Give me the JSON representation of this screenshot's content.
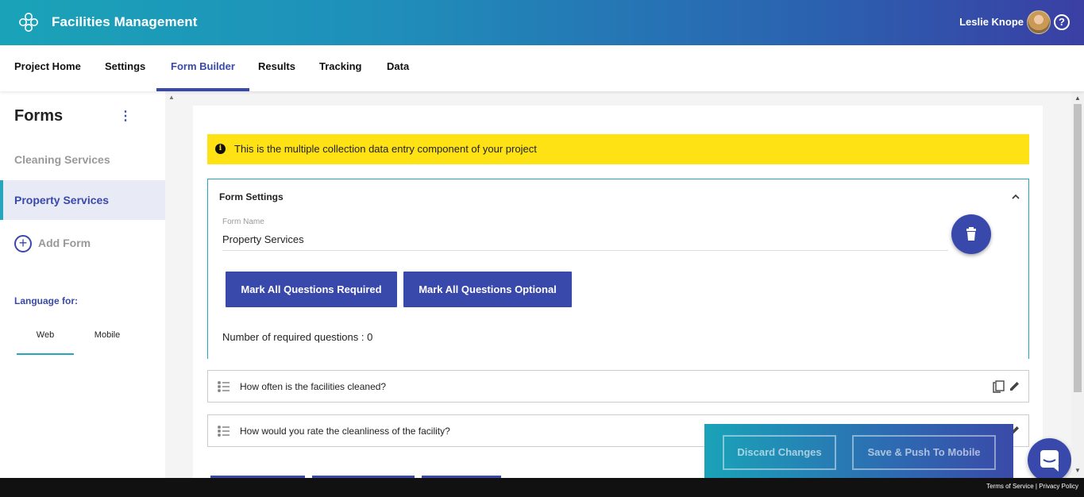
{
  "header": {
    "app_title": "Facilities Management",
    "user_name": "Leslie Knope",
    "logo_icon": "flower-logo-icon",
    "help_icon": "question-circle-icon",
    "help_glyph": "?"
  },
  "nav": {
    "tabs": [
      {
        "label": "Project Home"
      },
      {
        "label": "Settings"
      },
      {
        "label": "Form Builder",
        "active": true
      },
      {
        "label": "Results"
      },
      {
        "label": "Tracking"
      },
      {
        "label": "Data"
      }
    ]
  },
  "sidebar": {
    "title": "Forms",
    "forms": [
      {
        "label": "Cleaning Services"
      },
      {
        "label": "Property Services",
        "active": true
      }
    ],
    "add_form_label": "Add Form",
    "language_label": "Language for:",
    "language_tabs": [
      {
        "label": "Web",
        "active": true
      },
      {
        "label": "Mobile"
      }
    ]
  },
  "banner": {
    "message": "This is the multiple collection data entry component of your project",
    "icon": "info-icon"
  },
  "form_settings": {
    "title": "Form Settings",
    "form_name_label": "Form Name",
    "form_name_value": "Property Services",
    "mark_required_label": "Mark All Questions Required",
    "mark_optional_label": "Mark All Questions Optional",
    "required_count_text": "Number of required questions : 0"
  },
  "questions": [
    {
      "text": "How often is the facilities cleaned?"
    },
    {
      "text": "How would you rate the cleanliness of the facility?"
    }
  ],
  "action_bar": {
    "discard_label": "Discard Changes",
    "save_label": "Save & Push To Mobile"
  },
  "footer": {
    "terms": "Terms of Service",
    "privacy": "Privacy Policy",
    "separator": "|"
  },
  "colors": {
    "primary": "#3949ab",
    "accent": "#26a6bd",
    "banner": "#ffe213"
  }
}
